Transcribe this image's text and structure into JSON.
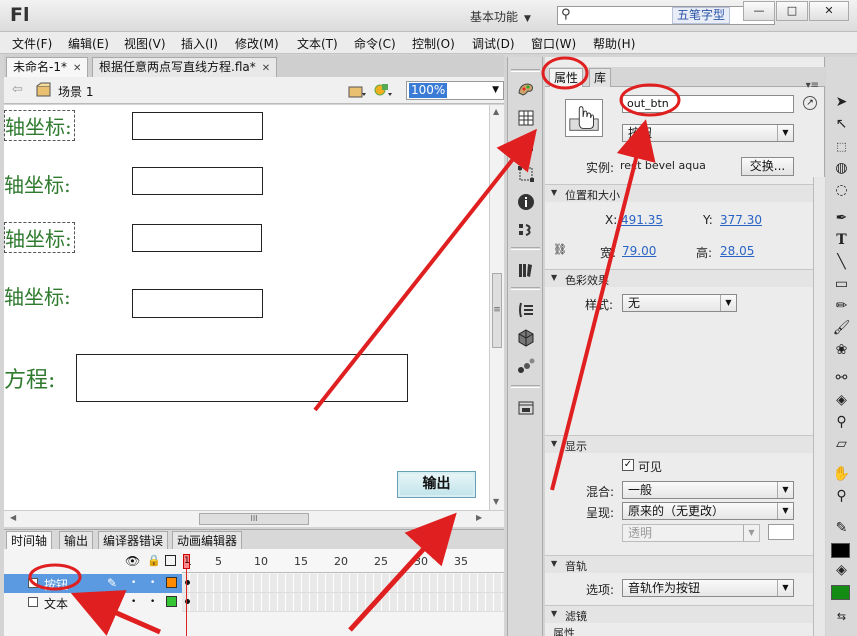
{
  "app": {
    "logo": "Fl",
    "workspace": "基本功能",
    "ime_label": "五笔字型",
    "window_buttons": [
      "—",
      "□",
      "✕"
    ]
  },
  "menu": [
    "文件(F)",
    "编辑(E)",
    "视图(V)",
    "插入(I)",
    "修改(M)",
    "文本(T)",
    "命令(C)",
    "控制(O)",
    "调试(D)",
    "窗口(W)",
    "帮助(H)"
  ],
  "doc_tabs": [
    {
      "label": "未命名-1*",
      "close": "✕"
    },
    {
      "label": "根据任意两点写直线方程.fla*",
      "close": "✕"
    }
  ],
  "edit_bar": {
    "scene": "场景 1",
    "zoom": "100%"
  },
  "stage": {
    "labels": [
      "轴坐标:",
      "轴坐标:",
      "轴坐标:",
      "轴坐标:",
      "方程:"
    ],
    "output_button": "输出"
  },
  "scroll": {
    "h_thumb": "III",
    "v_thumb": "≡"
  },
  "timeline": {
    "tabs": [
      "时间轴",
      "输出",
      "编译器错误",
      "动画编辑器"
    ],
    "frame_numbers": [
      "1",
      "5",
      "10",
      "15",
      "20",
      "25",
      "30",
      "35"
    ],
    "layers": [
      {
        "name": "按钮",
        "selected": true,
        "color": "#ff8a00"
      },
      {
        "name": "文本",
        "selected": false,
        "color": "#34c534"
      }
    ]
  },
  "properties": {
    "tabs": [
      "属性",
      "库"
    ],
    "instance_name": "out_btn",
    "symbol_type": "按钮",
    "instance_of_label": "实例:",
    "instance_of_value": "rect bevel aqua",
    "swap_button": "交换...",
    "sections": {
      "position_size": "位置和大小",
      "color_effect": "色彩效果",
      "display": "显示",
      "track": "音轨",
      "filters": "滤镜"
    },
    "x_label": "X:",
    "x_value": "491.35",
    "y_label": "Y:",
    "y_value": "377.30",
    "w_label": "宽:",
    "w_value": "79.00",
    "h_label": "高:",
    "h_value": "28.05",
    "style_label": "样式:",
    "style_value": "无",
    "visible_label": "可见",
    "blend_label": "混合:",
    "blend_value": "一般",
    "render_label": "呈现:",
    "render_value": "原来的（无更改）",
    "transparent_value": "透明",
    "options_label": "选项:",
    "options_value": "音轨作为按钮",
    "filter_col": "属性"
  },
  "colors": {
    "accent_red": "#e02020",
    "selection_blue": "#5b9ae0",
    "label_green": "#2f7a2f"
  }
}
